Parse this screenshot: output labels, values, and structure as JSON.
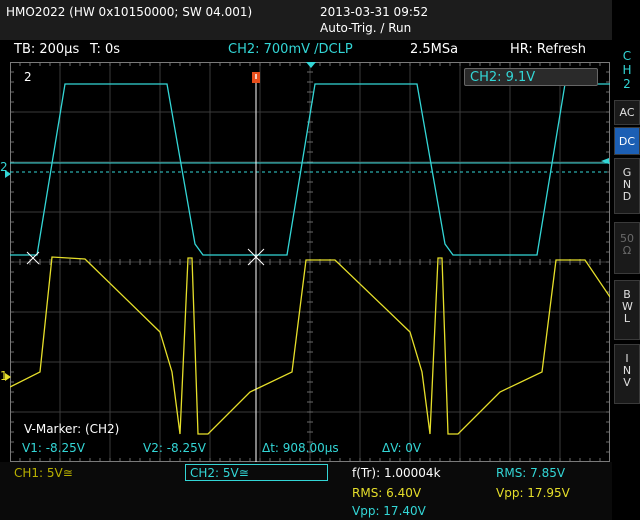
{
  "header": {
    "device": "HMO2022 (HW 0x10150000; SW 04.001)",
    "datetime": "2013-03-31 09:52",
    "trigger_mode": "Auto-Trig. / Run"
  },
  "status": {
    "timebase": "TB: 200µs",
    "trigger_time": "T: 0s",
    "ch2_scale": "CH2: 700mV /DCLP",
    "sample_rate": "2.5MSa",
    "hr_refresh": "HR: Refresh"
  },
  "screen": {
    "ch2_level_badge": "CH2: 9.1V",
    "ch2_marker": "2",
    "ch2_side_marker": "2",
    "ch1_side_marker": "1",
    "cursor_label": "V-Marker: (CH2)",
    "v1": "V1: -8.25V",
    "v2": "V2: -8.25V",
    "dt": "Δt: 908.00µs",
    "dv": "ΔV: 0V"
  },
  "footer": {
    "ch1": "CH1: 5V≅",
    "ch2": "CH2: 5V≅",
    "freq": "f(Tr): 1.00004k",
    "rms_ch1": "RMS: 6.40V",
    "vpp_ch1": "Vpp: 17.40V",
    "rms_ch2": "RMS: 7.85V",
    "vpp_ch2": "Vpp: 17.95V"
  },
  "sidebar": {
    "channel": [
      "C",
      "H",
      "2"
    ],
    "buttons": [
      {
        "label": "AC"
      },
      {
        "label": "DC"
      },
      {
        "label": "GND"
      },
      {
        "label": "50Ω"
      },
      {
        "label": "BWL"
      },
      {
        "label": "INV"
      }
    ]
  },
  "colors": {
    "ch1": "#e6df2a",
    "ch2": "#33d6d6",
    "grid": "#3a3a3a",
    "active_button": "#1c5fb4"
  }
}
